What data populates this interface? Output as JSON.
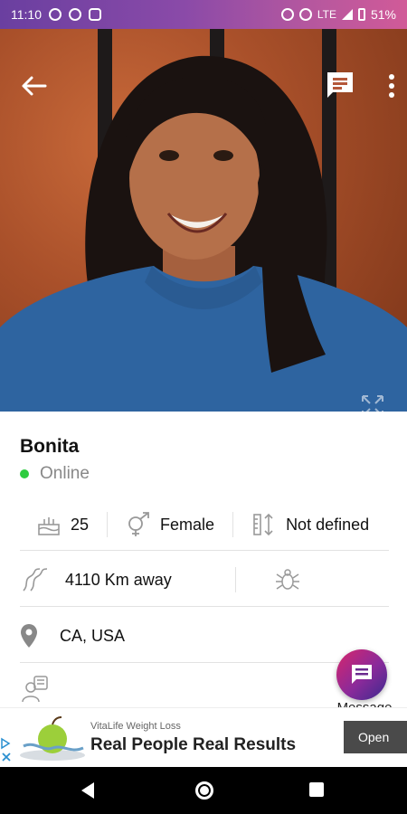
{
  "status_bar": {
    "time": "11:10",
    "network": "LTE",
    "battery": "51%",
    "left_icons": [
      "p-icon",
      "shield-icon",
      "camera-icon"
    ],
    "right_icons": [
      "alarm-icon",
      "dnd-icon",
      "signal-icon",
      "battery-icon"
    ]
  },
  "profile": {
    "name": "Bonita",
    "status": "Online",
    "age": "25",
    "gender": "Female",
    "height": "Not defined",
    "distance": "4110 Km away",
    "location": "CA, USA"
  },
  "actions": {
    "message_label": "Message"
  },
  "ad": {
    "sponsor": "VitaLife Weight Loss",
    "headline": "Real People Real Results",
    "cta": "Open"
  },
  "colors": {
    "accent_gradient_start": "#d7266c",
    "accent_gradient_end": "#3b2a8e",
    "online_dot": "#2ecc40"
  }
}
